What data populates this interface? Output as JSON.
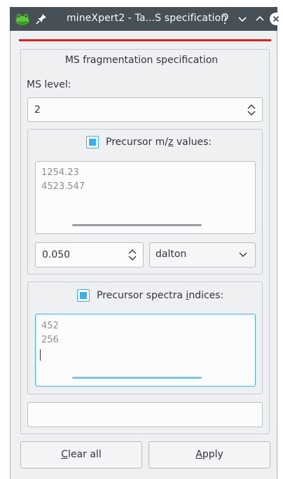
{
  "window": {
    "title": "mineXpert2 - Ta...S specification",
    "title_bar_color": "#475057",
    "accent_line_color": "#da2020",
    "icons": {
      "app": "frog-app-icon",
      "pin": "pin-icon",
      "help": "question-mark-icon",
      "minimize": "chevron-down-icon",
      "maximize": "chevron-up-icon",
      "close": "close-circle-icon"
    }
  },
  "form": {
    "group_title": "MS fragmentation specification",
    "ms_level_label": "MS level:",
    "ms_level_value": "2",
    "precursor_mz": {
      "checked": true,
      "label_pre": "Precursor m/",
      "label_mnemonic": "z",
      "label_post": " values:",
      "values": [
        "1254.23",
        "4523.547"
      ],
      "tolerance_value": "0.050",
      "unit_selected": "dalton"
    },
    "precursor_indices": {
      "checked": true,
      "label_pre": "Precursor spectra ",
      "label_mnemonic": "i",
      "label_post": "ndices:",
      "values": [
        "452",
        "256"
      ]
    }
  },
  "buttons": {
    "clear_mnemonic": "C",
    "clear_rest": "lear all",
    "apply_mnemonic": "A",
    "apply_rest": "pply"
  },
  "colors": {
    "accent_blue": "#3daee9",
    "window_bg": "#eff0f1"
  }
}
